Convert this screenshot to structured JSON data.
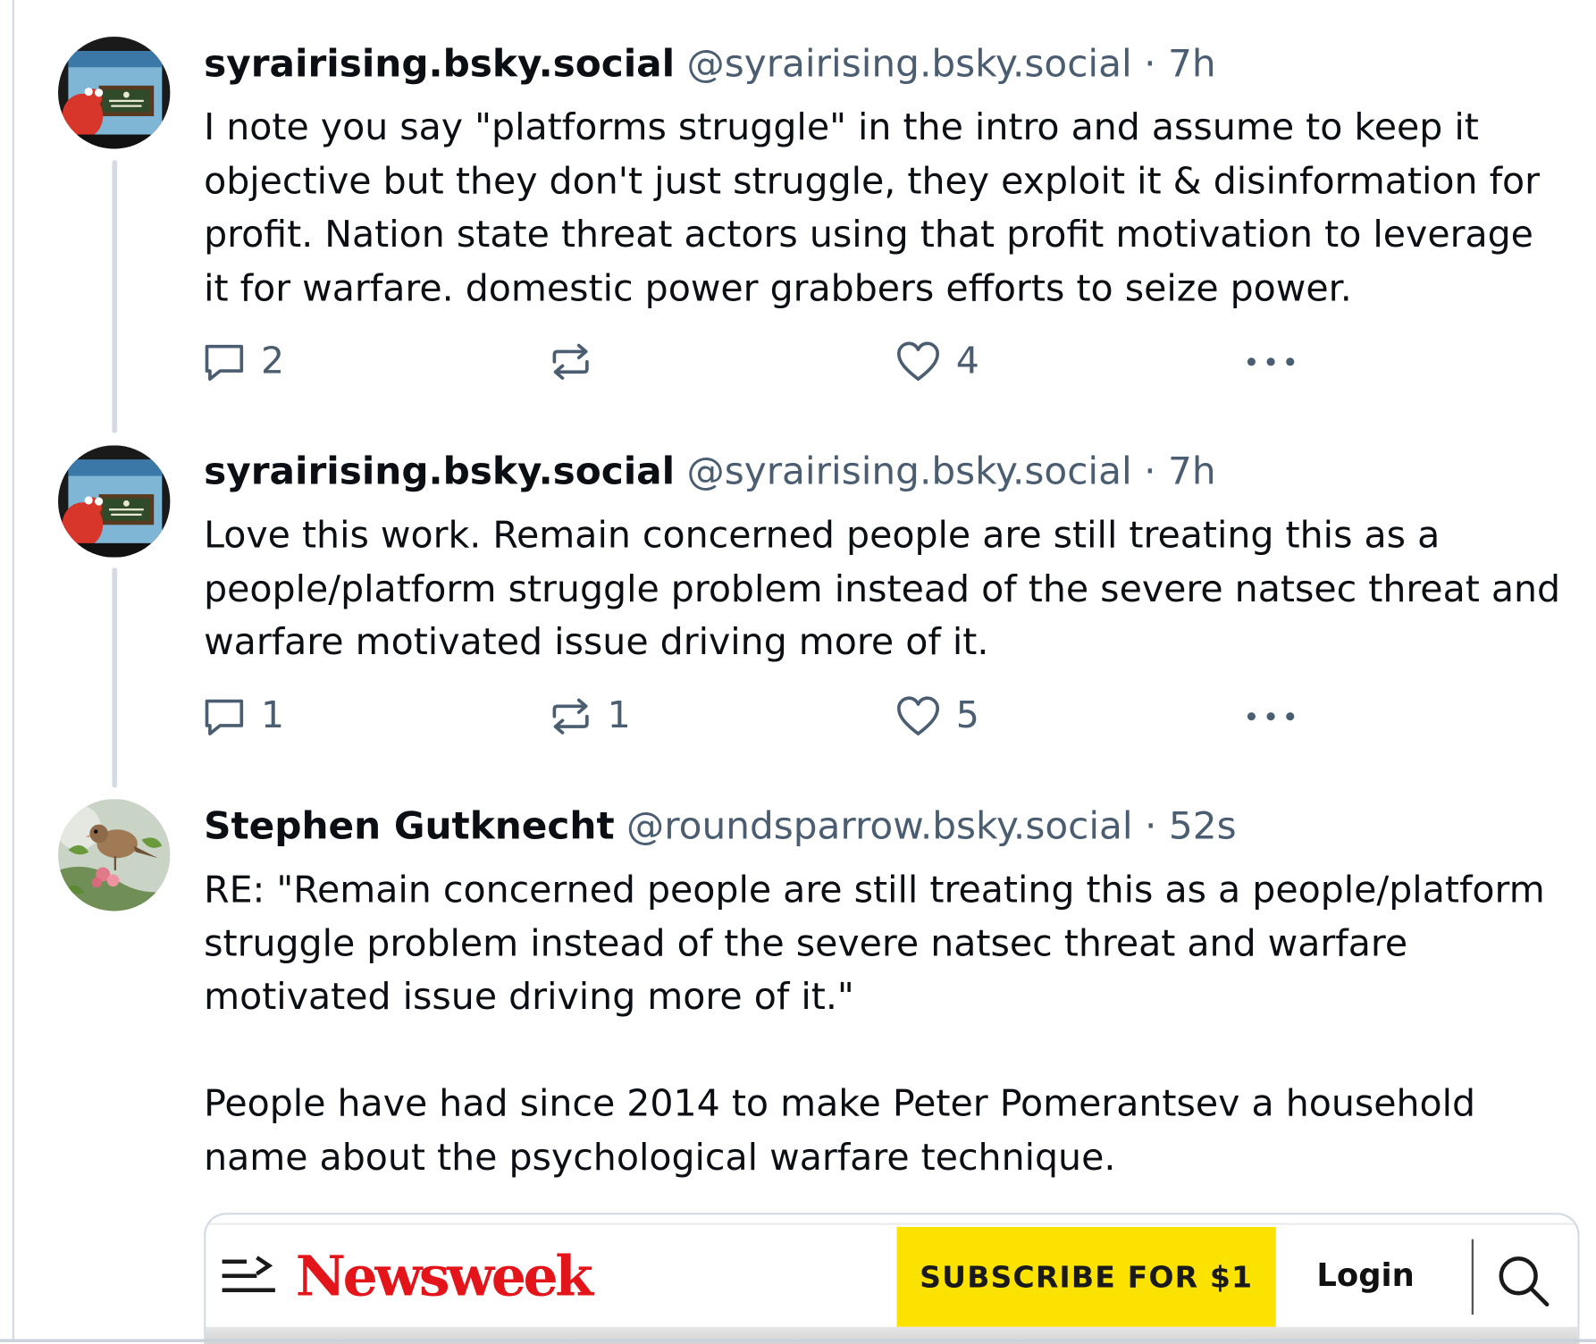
{
  "posts": [
    {
      "display_name": "syrairising.bsky.social",
      "handle": "@syrairising.bsky.social",
      "separator": "·",
      "time": "7h",
      "text": "I note you say \"platforms struggle\" in the intro and assume to keep it objective but they don't just struggle, they exploit it & disinformation for profit. Nation state threat actors using that profit motivation to leverage it for warfare. domestic power grabbers efforts to seize power.",
      "replies": "2",
      "reposts": "",
      "likes": "4"
    },
    {
      "display_name": "syrairising.bsky.social",
      "handle": "@syrairising.bsky.social",
      "separator": "·",
      "time": "7h",
      "text": "Love this work.  Remain concerned people are still treating this as a people/platform struggle problem instead of the severe natsec threat and warfare motivated issue driving more of it.",
      "replies": "1",
      "reposts": "1",
      "likes": "5"
    },
    {
      "display_name": "Stephen Gutknecht",
      "handle": "@roundsparrow.bsky.social",
      "separator": "·",
      "time": "52s",
      "text": "RE: \"Remain concerned people are still treating this as a people/platform struggle problem instead of the severe natsec threat and warfare motivated issue driving more of it.\"\n\nPeople have had since 2014 to make Peter Pomerantsev a household name about the psychological warfare technique."
    }
  ],
  "link_card": {
    "brand": "Newsweek",
    "subscribe_label": "SUBSCRIBE FOR $1",
    "login_label": "Login"
  },
  "colors": {
    "text": "#0b0f14",
    "muted": "#4b5d70",
    "thread_line": "#d4dbe3",
    "newsweek_red": "#e3151b",
    "subscribe_yellow": "#fbe200"
  },
  "icons": {
    "reply": "speech-bubble",
    "repost": "two-arrows-loop",
    "like": "heart-outline",
    "more": "three-dots",
    "menu": "hamburger-arrow",
    "search": "magnifier"
  }
}
